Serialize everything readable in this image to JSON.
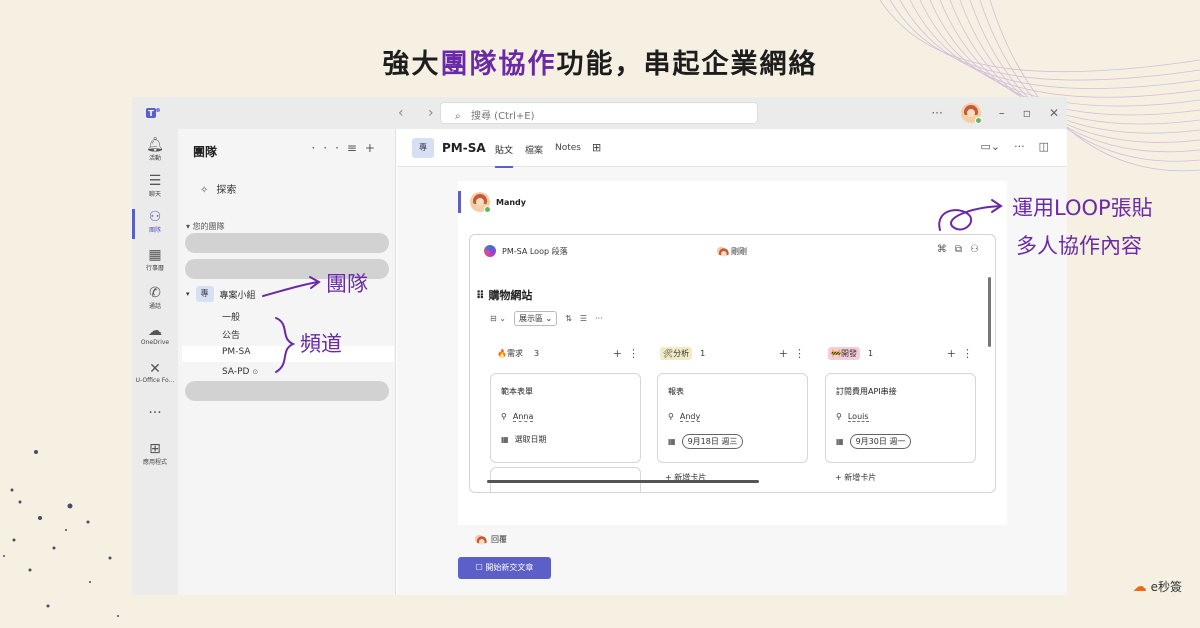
{
  "headline": {
    "part1": "強大",
    "highlight": "團隊協作",
    "part2": "功能，串起企業網絡"
  },
  "annotations": {
    "loop": "運用LOOP張貼",
    "loop_line2": "多人協作內容",
    "team": "團隊",
    "channel": "頻道"
  },
  "brand": {
    "name": "e秒簽"
  },
  "titlebar": {
    "search_placeholder": "搜尋 (Ctrl+E)",
    "more": "···"
  },
  "rail": [
    {
      "icon": "bell-icon",
      "glyph": "🔔︎",
      "label": "活動"
    },
    {
      "icon": "chat-icon",
      "glyph": "☰",
      "label": "聊天"
    },
    {
      "icon": "teams-icon",
      "glyph": "⚇",
      "label": "團隊"
    },
    {
      "icon": "calendar-icon",
      "glyph": "▦",
      "label": "行事曆"
    },
    {
      "icon": "phone-icon",
      "glyph": "✆",
      "label": "通話"
    },
    {
      "icon": "cloud-icon",
      "glyph": "☁",
      "label": "OneDrive"
    },
    {
      "icon": "uoffice-icon",
      "glyph": "✕",
      "label": "U-Office Fo..."
    },
    {
      "icon": "more-icon",
      "glyph": "···",
      "label": ""
    },
    {
      "icon": "apps-icon",
      "glyph": "⊞",
      "label": "應用程式"
    }
  ],
  "panel": {
    "title": "團隊",
    "explore": "探索",
    "section": "您的團隊",
    "team_badge": "專",
    "team_name": "專案小組",
    "channels": [
      "一般",
      "公告",
      "PM-SA",
      "SA-PD"
    ]
  },
  "channel": {
    "badge": "專",
    "name": "PM-SA",
    "tabs": [
      "貼文",
      "檔案",
      "Notes"
    ]
  },
  "post": {
    "author": "Mandy",
    "loop_title": "PM-SA Loop 段落",
    "loop_viewer": "剛剛",
    "board_title": "購物網站",
    "view_label": "展示區",
    "reply": "回覆",
    "compose": "開始新交文章"
  },
  "board": {
    "columns": [
      {
        "icon": "🔥",
        "label": "需求",
        "count": "3",
        "color": "#fde3cf"
      },
      {
        "icon": "🛠",
        "label": "分析",
        "count": "1",
        "color": "#f1eac6"
      },
      {
        "icon": "🚧",
        "label": "開發",
        "count": "1",
        "color": "#f6cfd6"
      }
    ],
    "cards": [
      {
        "title": "範本表單",
        "user": "Anna",
        "date": "選取日期",
        "has_pill": false
      },
      {
        "title": "報表",
        "user": "Andy",
        "date": "9月18日 週三",
        "has_pill": true
      },
      {
        "title": "訂閱費用API串接",
        "user": "Louis",
        "date": "9月30日 週一",
        "has_pill": true
      }
    ],
    "add_card": "新增卡片"
  }
}
